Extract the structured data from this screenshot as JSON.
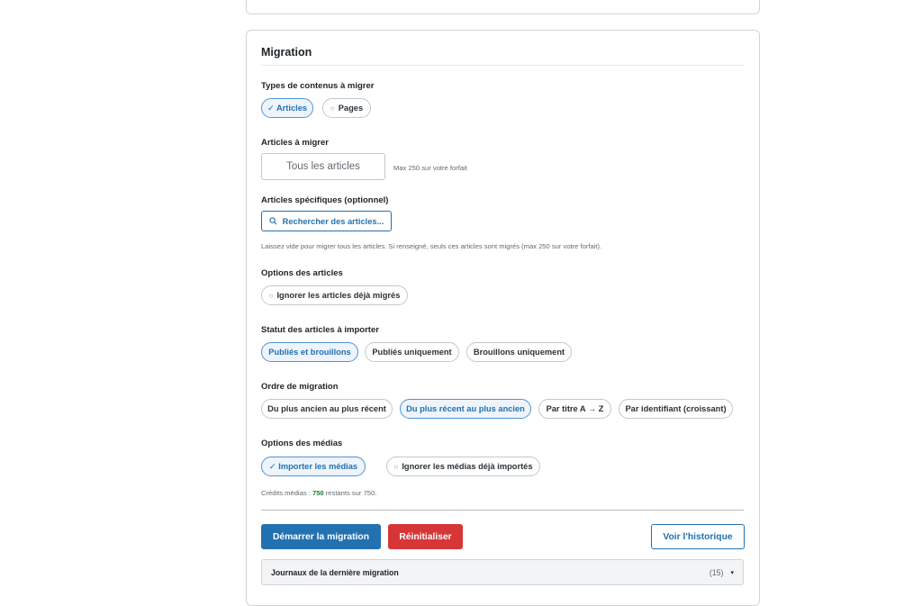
{
  "migration": {
    "title": "Migration",
    "content_types": {
      "label": "Types de contenus à migrer",
      "options": [
        {
          "text": "✓ Articles",
          "selected": true
        },
        {
          "text": "Pages",
          "selected": false
        }
      ]
    },
    "articles_count": {
      "label": "Articles à migrer",
      "placeholder": "Tous les articles",
      "limit_hint": "Max 250 sur votre forfait"
    },
    "specific_articles": {
      "label": "Articles spécifiques (optionnel)",
      "search_button": "Rechercher des articles...",
      "help": "Laissez vide pour migrer tous les articles. Si renseigné, seuls ces articles sont migrés (max 250 sur votre forfait)."
    },
    "article_options": {
      "label": "Options des articles",
      "options": [
        {
          "text": "Ignorer les articles déjà migrés",
          "selected": false
        }
      ]
    },
    "status": {
      "label": "Statut des articles à importer",
      "options": [
        {
          "text": "Publiés et brouillons",
          "selected": true
        },
        {
          "text": "Publiés uniquement",
          "selected": false
        },
        {
          "text": "Brouillons uniquement",
          "selected": false
        }
      ]
    },
    "order": {
      "label": "Ordre de migration",
      "options": [
        {
          "text": "Du plus ancien au plus récent",
          "selected": false
        },
        {
          "text": "Du plus récent au plus ancien",
          "selected": true
        },
        {
          "text": "Par titre A → Z",
          "selected": false
        },
        {
          "text": "Par identifiant (croissant)",
          "selected": false
        }
      ]
    },
    "media": {
      "label": "Options des médias",
      "options": [
        {
          "text": "✓ Importer les médias",
          "selected": true
        },
        {
          "text": "Ignorer les médias déjà importés",
          "selected": false
        }
      ],
      "credits_prefix": "Crédits médias : ",
      "credits_value": "750",
      "credits_suffix": " restants sur 750."
    },
    "actions": {
      "start": "Démarrer la migration",
      "reset": "Réinitialiser",
      "history": "Voir l'historique"
    },
    "logs": {
      "title": "Journaux de la dernière migration",
      "count": "(15)",
      "caret": "▾"
    }
  },
  "colors": {
    "primary": "#2271b1",
    "danger": "#d63638",
    "success": "#1a7f37"
  }
}
